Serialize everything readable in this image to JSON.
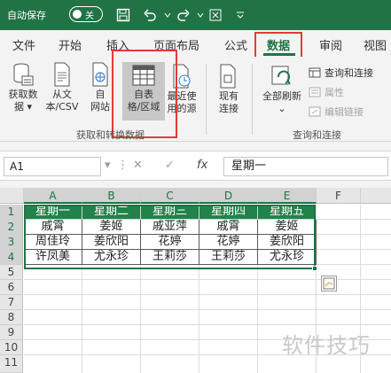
{
  "titlebar": {
    "autosave_label": "自动保存",
    "toggle_state": "关"
  },
  "tabs": [
    "文件",
    "开始",
    "插入",
    "页面布局",
    "公式",
    "数据",
    "审阅",
    "视图"
  ],
  "active_tab": "数据",
  "ribbon": {
    "get_data": "获取数据",
    "get_data_arrow": "据 ▾",
    "from_text": "从文本/CSV",
    "from_web": "自网站",
    "from_table": "自表格/区域",
    "recent_sources": "最近使用的源",
    "existing_conn": "现有连接",
    "group1_label": "获取和转换数据",
    "refresh_all": "全部刷新",
    "queries_conn": "查询和连接",
    "properties": "属性",
    "edit_links": "编辑链接",
    "group2_label": "查询和连接"
  },
  "formula_bar": {
    "name_box": "A1",
    "cancel": "✕",
    "enter": "✓",
    "fx": "fx",
    "content": "星期一"
  },
  "columns": [
    "A",
    "B",
    "C",
    "D",
    "E",
    "F"
  ],
  "rows": [
    "1",
    "2",
    "3",
    "4",
    "5",
    "6",
    "7",
    "8",
    "9",
    "10",
    "11"
  ],
  "table": {
    "header": [
      "星期一",
      "星期二",
      "星期三",
      "星期四",
      "星期五"
    ],
    "body": [
      [
        "戚霄",
        "姜姬",
        "戚亚萍",
        "戚霄",
        "姜姬"
      ],
      [
        "周佳玲",
        "姜欣阳",
        "花婷",
        "花婷",
        "姜欣阳"
      ],
      [
        "许凤美",
        "尤永珍",
        "王莉莎",
        "王莉莎",
        "尤永珍"
      ]
    ]
  },
  "watermark": "软件技巧",
  "colors": {
    "excel_green": "#217346",
    "highlight_red": "#e53935"
  }
}
